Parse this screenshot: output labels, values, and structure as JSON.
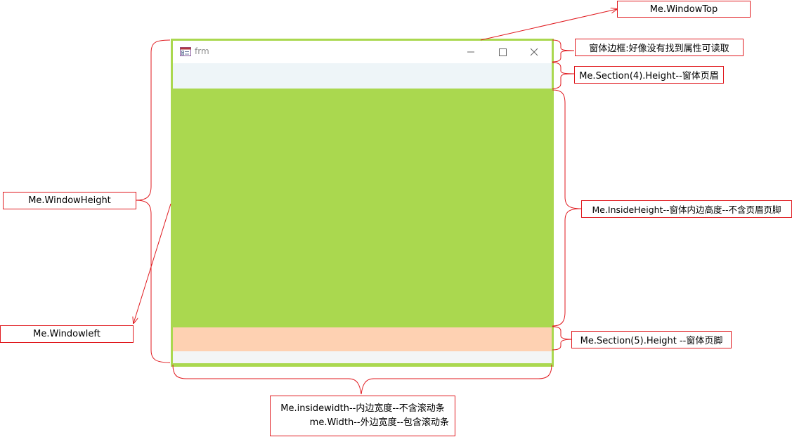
{
  "form": {
    "title": "frm",
    "icon": "form-icon",
    "controls": [
      "minimize-icon",
      "maximize-icon",
      "close-icon"
    ]
  },
  "labels": {
    "window_top": "Me.WindowTop",
    "border": "窗体边框:好像没有找到属性可读取",
    "header_height": "Me.Section(4).Height--窗体页眉",
    "inside_height": "Me.InsideHeight--窗体内边高度--不含页眉页脚",
    "footer_height": "Me.Section(5).Height --窗体页脚",
    "window_height": "Me.WindowHeight",
    "window_left": "Me.Windowleft",
    "inside_width": "Me.insidewidth--内边宽度--不含滚动条",
    "width": "me.Width--外边宽度--包含滚动条"
  },
  "colors": {
    "annotation": "#e0191e",
    "frame": "#aad84f",
    "detail": "#aad84f",
    "header": "#eef5f8",
    "footer": "#fed1b2",
    "bottom_strip": "#f3f5f6"
  }
}
